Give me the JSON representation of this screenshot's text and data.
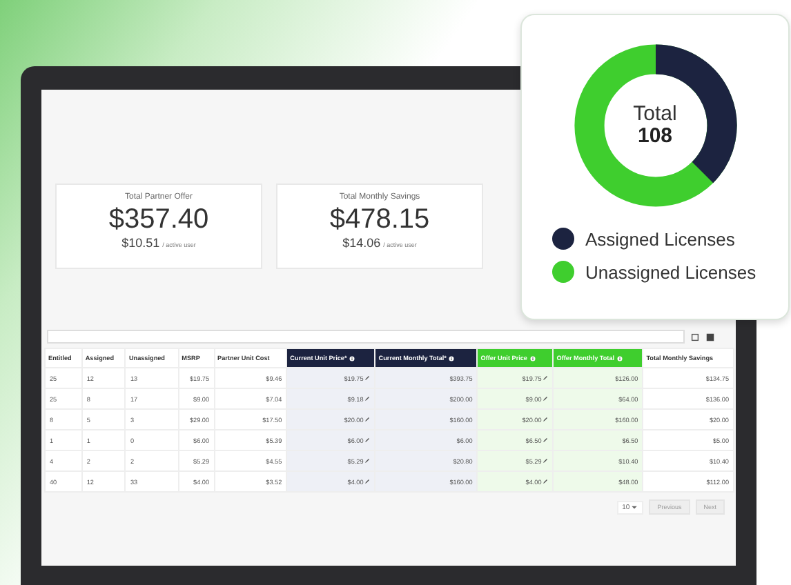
{
  "summary_cards": [
    {
      "title": "Total Partner Offer",
      "amount": "$357.40",
      "per_user": "$10.51",
      "per_user_label": "/ active user"
    },
    {
      "title": "Total Monthly Savings",
      "amount": "$478.15",
      "per_user": "$14.06",
      "per_user_label": "/ active user"
    }
  ],
  "table": {
    "columns": [
      {
        "label": "Entitled",
        "kind": "plain"
      },
      {
        "label": "Assigned",
        "kind": "plain"
      },
      {
        "label": "Unassigned",
        "kind": "plain"
      },
      {
        "label": "MSRP",
        "kind": "plain"
      },
      {
        "label": "Partner Unit Cost",
        "kind": "plain"
      },
      {
        "label": "Current Unit Price*",
        "kind": "current"
      },
      {
        "label": "Current Monthly Total*",
        "kind": "current"
      },
      {
        "label": "Offer Unit Price",
        "kind": "offer"
      },
      {
        "label": "Offer Monthly Total",
        "kind": "offer"
      },
      {
        "label": "Total Monthly Savings",
        "kind": "plain"
      }
    ],
    "rows": [
      [
        "25",
        "12",
        "13",
        "$19.75",
        "$9.46",
        "$19.75",
        "$393.75",
        "$19.75",
        "$126.00",
        "$134.75"
      ],
      [
        "25",
        "8",
        "17",
        "$9.00",
        "$7.04",
        "$9.18",
        "$200.00",
        "$9.00",
        "$64.00",
        "$136.00"
      ],
      [
        "8",
        "5",
        "3",
        "$29.00",
        "$17.50",
        "$20.00",
        "$160.00",
        "$20.00",
        "$160.00",
        "$20.00"
      ],
      [
        "1",
        "1",
        "0",
        "$6.00",
        "$5.39",
        "$6.00",
        "$6.00",
        "$6.50",
        "$6.50",
        "$5.00"
      ],
      [
        "4",
        "2",
        "2",
        "$5.29",
        "$4.55",
        "$5.29",
        "$20.80",
        "$5.29",
        "$10.40",
        "$10.40"
      ],
      [
        "40",
        "12",
        "33",
        "$4.00",
        "$3.52",
        "$4.00",
        "$160.00",
        "$4.00",
        "$48.00",
        "$112.00"
      ]
    ]
  },
  "pagination": {
    "page_size": "10",
    "previous": "Previous",
    "next": "Next"
  },
  "license_card": {
    "total_label": "Total",
    "total": "108",
    "legend": [
      {
        "label": "Assigned Licenses",
        "color": "#1c2340"
      },
      {
        "label": "Unassigned Licenses",
        "color": "#3fce2e"
      }
    ]
  }
}
